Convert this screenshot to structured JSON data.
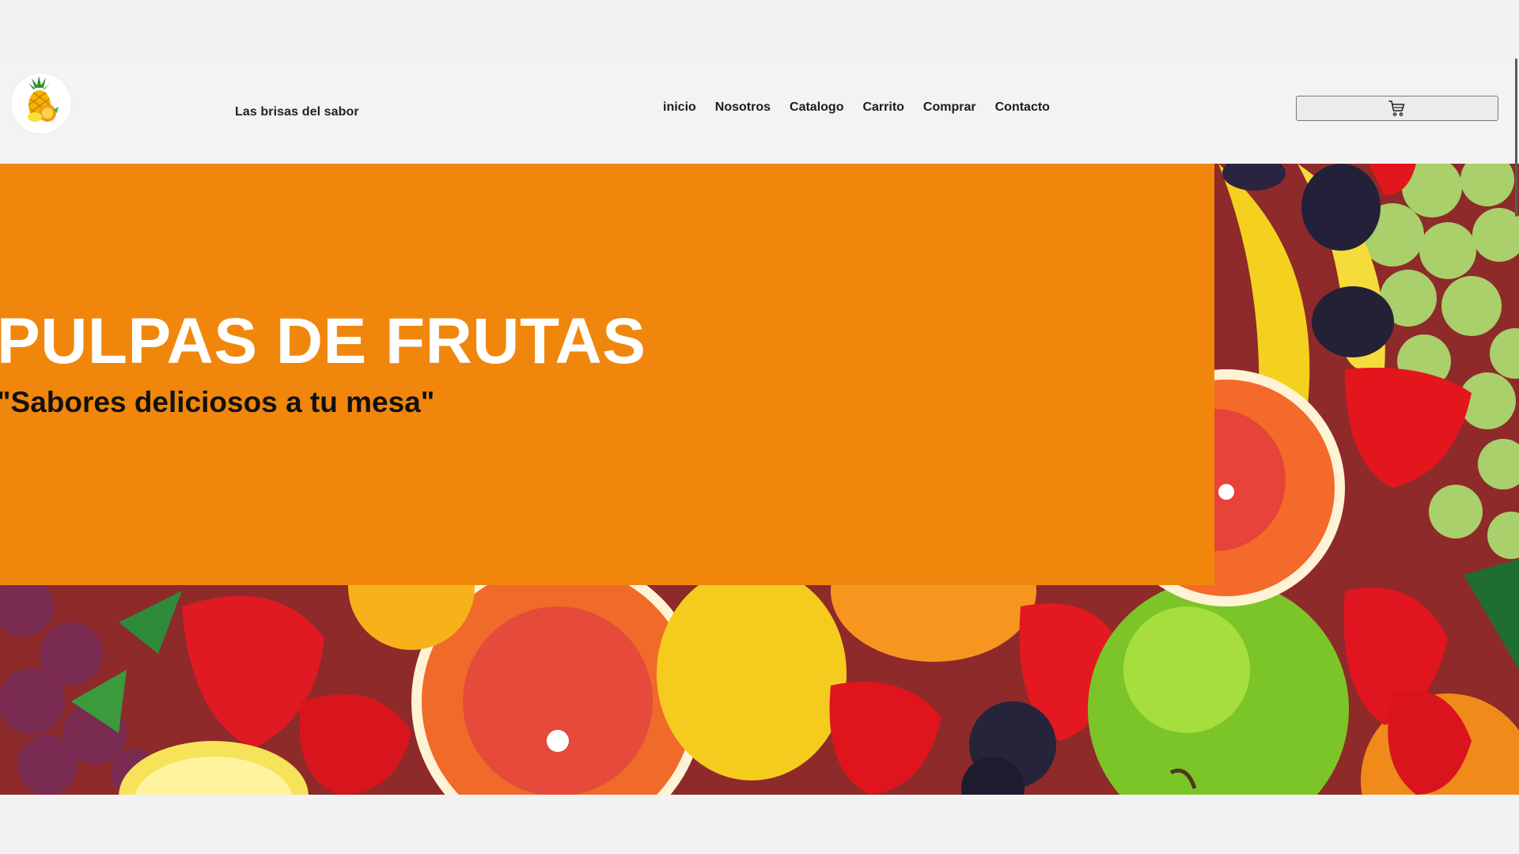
{
  "header": {
    "brand_name": "Las brisas del sabor",
    "logo_icon": "pineapple-logo-icon",
    "cart_icon": "cart-icon"
  },
  "nav": {
    "items": [
      {
        "label": "inicio"
      },
      {
        "label": "Nosotros"
      },
      {
        "label": "Catalogo"
      },
      {
        "label": "Carrito"
      },
      {
        "label": "Comprar"
      },
      {
        "label": "Contacto"
      }
    ]
  },
  "hero": {
    "title": "PULPAS DE FRUTAS",
    "subtitle": "\"Sabores deliciosos a tu mesa\"",
    "panel_color": "#f0870c",
    "background_image": "assorted-fruits-image"
  }
}
